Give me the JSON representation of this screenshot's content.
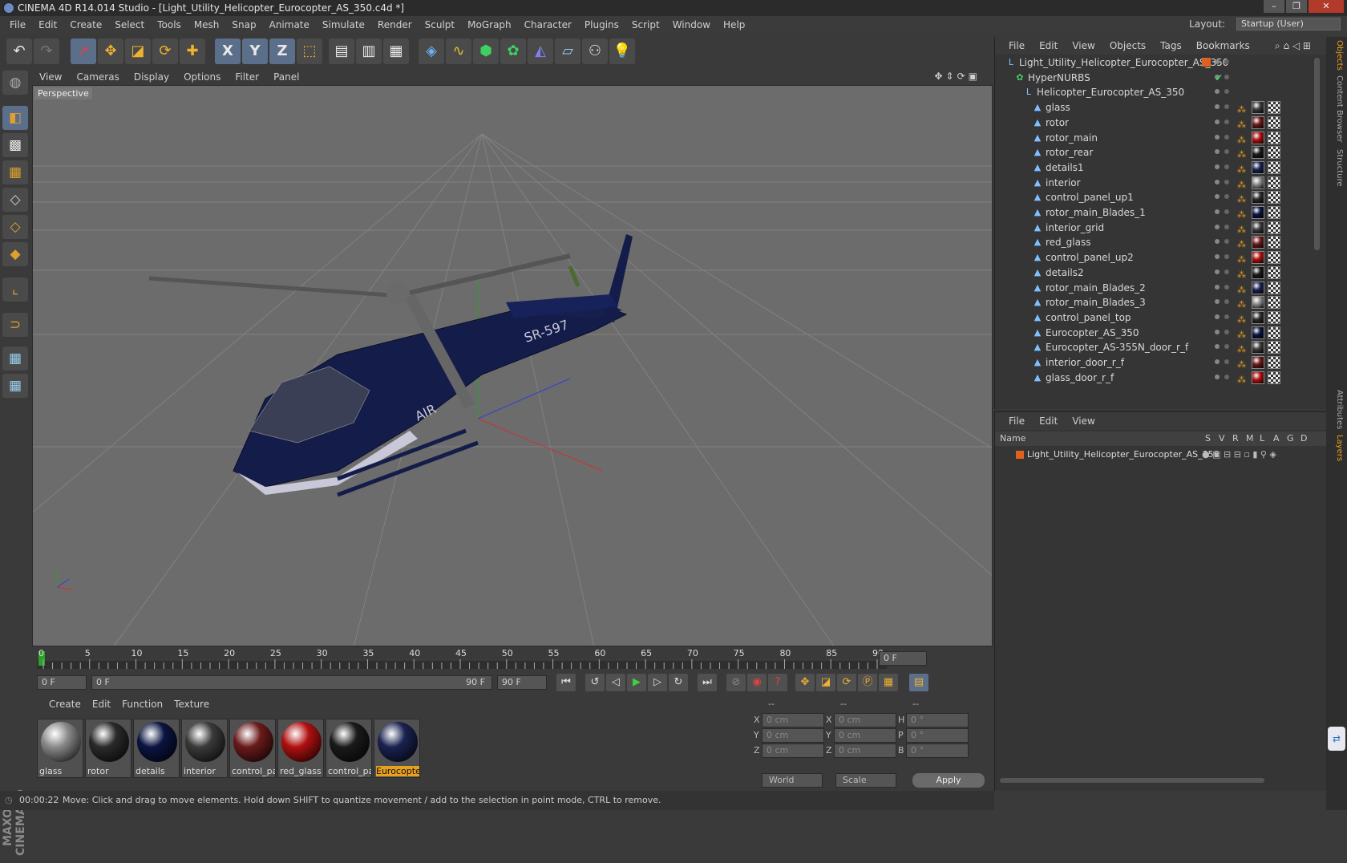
{
  "window": {
    "title": "CINEMA 4D R14.014 Studio - [Light_Utility_Helicopter_Eurocopter_AS_350.c4d *]"
  },
  "menu": [
    "File",
    "Edit",
    "Create",
    "Select",
    "Tools",
    "Mesh",
    "Snap",
    "Animate",
    "Simulate",
    "Render",
    "Sculpt",
    "MoGraph",
    "Character",
    "Plugins",
    "Script",
    "Window",
    "Help"
  ],
  "layout": {
    "label": "Layout:",
    "value": "Startup (User)"
  },
  "viewport": {
    "menu": [
      "View",
      "Cameras",
      "Display",
      "Options",
      "Filter",
      "Panel"
    ],
    "label": "Perspective",
    "heli_text": "SR-597",
    "heli_text2": "AIR"
  },
  "toolbar": {
    "x": "X",
    "y": "Y",
    "z": "Z"
  },
  "timeline": {
    "ticks": [
      "0",
      "5",
      "10",
      "15",
      "20",
      "25",
      "30",
      "35",
      "40",
      "45",
      "50",
      "55",
      "60",
      "65",
      "70",
      "75",
      "80",
      "85",
      "90"
    ],
    "current_frame": "0 F"
  },
  "transport": {
    "start": "0 F",
    "range_start": "0 F",
    "range_end": "90 F",
    "end": "90 F"
  },
  "materials": {
    "menu": [
      "Create",
      "Edit",
      "Function",
      "Texture"
    ],
    "items": [
      {
        "name": "glass",
        "color": "#8a8a8a"
      },
      {
        "name": "rotor",
        "color": "#2a2a2a"
      },
      {
        "name": "details",
        "color": "#0a1440"
      },
      {
        "name": "interior",
        "color": "#3a3a3a"
      },
      {
        "name": "control_pa",
        "color": "#6a1a1a"
      },
      {
        "name": "red_glass",
        "color": "#b01010"
      },
      {
        "name": "control_pa",
        "color": "#1a1a1a"
      },
      {
        "name": "Eurocopter",
        "color": "#1a2250"
      }
    ]
  },
  "coords": {
    "head": [
      "--",
      "--",
      "--"
    ],
    "rows": [
      {
        "a": "X",
        "av": "0 cm",
        "b": "X",
        "bv": "0 cm",
        "c": "H",
        "cv": "0 °"
      },
      {
        "a": "Y",
        "av": "0 cm",
        "b": "Y",
        "bv": "0 cm",
        "c": "P",
        "cv": "0 °"
      },
      {
        "a": "Z",
        "av": "0 cm",
        "b": "Z",
        "bv": "0 cm",
        "c": "B",
        "cv": "0 °"
      }
    ],
    "world": "World",
    "scale": "Scale",
    "apply": "Apply"
  },
  "status": {
    "time": "00:00:22",
    "message": "Move: Click and drag to move elements. Hold down SHIFT to quantize movement / add to the selection in point mode, CTRL to remove."
  },
  "objects": {
    "menu": [
      "File",
      "Edit",
      "View",
      "Objects",
      "Tags",
      "Bookmarks"
    ],
    "rows": [
      {
        "name": "Light_Utility_Helicopter_Eurocopter_AS_350",
        "depth": 0,
        "icon": "null"
      },
      {
        "name": "HyperNURBS",
        "depth": 1,
        "icon": "nurbs"
      },
      {
        "name": "Helicopter_Eurocopter_AS_350",
        "depth": 2,
        "icon": "null"
      },
      {
        "name": "glass",
        "depth": 3,
        "icon": "poly"
      },
      {
        "name": "rotor",
        "depth": 3,
        "icon": "poly"
      },
      {
        "name": "rotor_main",
        "depth": 3,
        "icon": "poly"
      },
      {
        "name": "rotor_rear",
        "depth": 3,
        "icon": "poly"
      },
      {
        "name": "details1",
        "depth": 3,
        "icon": "poly"
      },
      {
        "name": "interior",
        "depth": 3,
        "icon": "poly"
      },
      {
        "name": "control_panel_up1",
        "depth": 3,
        "icon": "poly"
      },
      {
        "name": "rotor_main_Blades_1",
        "depth": 3,
        "icon": "poly"
      },
      {
        "name": "interior_grid",
        "depth": 3,
        "icon": "poly"
      },
      {
        "name": "red_glass",
        "depth": 3,
        "icon": "poly"
      },
      {
        "name": "control_panel_up2",
        "depth": 3,
        "icon": "poly"
      },
      {
        "name": "details2",
        "depth": 3,
        "icon": "poly"
      },
      {
        "name": "rotor_main_Blades_2",
        "depth": 3,
        "icon": "poly"
      },
      {
        "name": "rotor_main_Blades_3",
        "depth": 3,
        "icon": "poly"
      },
      {
        "name": "control_panel_top",
        "depth": 3,
        "icon": "poly"
      },
      {
        "name": "Eurocopter_AS_350",
        "depth": 3,
        "icon": "poly"
      },
      {
        "name": "Eurocopter_AS-355N_door_r_f",
        "depth": 3,
        "icon": "poly"
      },
      {
        "name": "interior_door_r_f",
        "depth": 3,
        "icon": "poly"
      },
      {
        "name": "glass_door_r_f",
        "depth": 3,
        "icon": "poly"
      }
    ]
  },
  "layers": {
    "menu": [
      "File",
      "Edit",
      "View"
    ],
    "head_name": "Name",
    "head_cols": [
      "S",
      "V",
      "R",
      "M",
      "L",
      "A",
      "G",
      "D"
    ],
    "row": "Light_Utility_Helicopter_Eurocopter_AS_350"
  },
  "side_tabs": [
    "Objects",
    "Content Browser",
    "Structure",
    "Attributes",
    "Layers"
  ],
  "colors": {
    "accent": "#e8a020",
    "selection": "#5c6f8a"
  }
}
